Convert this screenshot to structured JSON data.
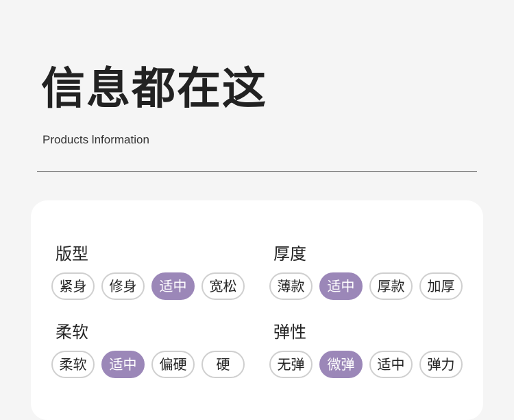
{
  "header": {
    "title": "信息都在这",
    "subtitle": "Products lnformation"
  },
  "colors": {
    "selected": "#9b87b8",
    "pill_border": "#cfcfcf",
    "background": "#f5f5f5",
    "card": "#ffffff"
  },
  "groups": [
    {
      "label": "版型",
      "options": [
        "紧身",
        "修身",
        "适中",
        "宽松"
      ],
      "selected": "适中"
    },
    {
      "label": "厚度",
      "options": [
        "薄款",
        "适中",
        "厚款",
        "加厚"
      ],
      "selected": "适中"
    },
    {
      "label": "柔软",
      "options": [
        "柔软",
        "适中",
        "偏硬",
        "硬"
      ],
      "selected": "适中"
    },
    {
      "label": "弹性",
      "options": [
        "无弹",
        "微弹",
        "适中",
        "弹力"
      ],
      "selected": "微弹"
    }
  ]
}
